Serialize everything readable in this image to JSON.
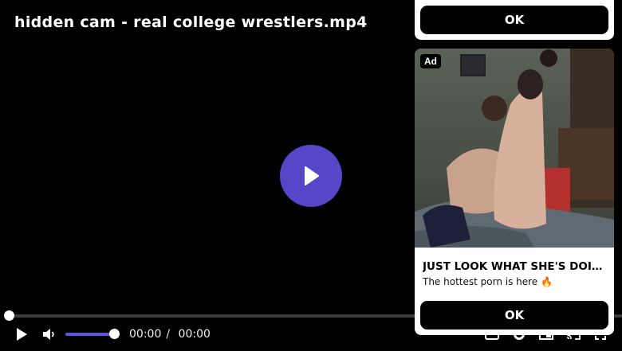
{
  "player": {
    "title": "hidden cam - real college wrestlers.mp4",
    "current_time": "00:00",
    "separator": "/",
    "duration": "00:00",
    "progress_fraction": 0,
    "volume_fraction": 1,
    "accent_color": "#5846c9",
    "icons": [
      "play-icon",
      "volume-icon",
      "captions-icon",
      "settings-icon",
      "pip-icon",
      "cast-icon",
      "fullscreen-icon"
    ]
  },
  "ads": {
    "top_ok_label": "OK",
    "card": {
      "badge": "Ad",
      "headline": "JUST LOOK WHAT SHE'S DOING ...",
      "subtext": "The hottest porn is here 🔥",
      "ok_label": "OK"
    }
  }
}
